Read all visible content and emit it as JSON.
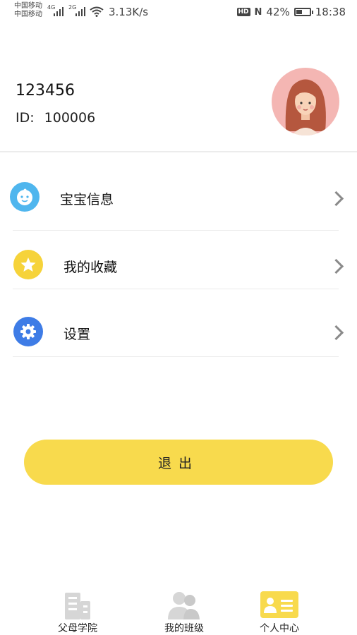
{
  "status_bar": {
    "carrier_1": "中国移动",
    "carrier_2": "中国移动",
    "net_1": "4G",
    "net_2": "2G",
    "speed": "3.13K/s",
    "hd_icon": "HD",
    "nfc_icon": "N",
    "battery_percent": "42%",
    "battery_level": 0.42,
    "time": "18:38"
  },
  "profile": {
    "username": "123456",
    "id_label": "ID:",
    "id_value": "100006",
    "avatar_icon": "woman-avatar"
  },
  "menu": [
    {
      "label": "宝宝信息",
      "icon": "baby-face-icon",
      "icon_color": "#4fb6ee"
    },
    {
      "label": "我的收藏",
      "icon": "star-icon",
      "icon_color": "#f6d33a"
    },
    {
      "label": "设置",
      "icon": "gear-icon",
      "icon_color": "#3e7ce6"
    }
  ],
  "logout_label": "退出",
  "tabs": [
    {
      "label": "父母学院",
      "icon": "building-icon",
      "active": false
    },
    {
      "label": "我的班级",
      "icon": "class-group-icon",
      "active": false
    },
    {
      "label": "个人中心",
      "icon": "id-card-icon",
      "active": true
    }
  ],
  "colors": {
    "accent": "#f8da4d",
    "inactive_icon": "#d6d6d6",
    "avatar_bg": "#f4b6b3"
  }
}
